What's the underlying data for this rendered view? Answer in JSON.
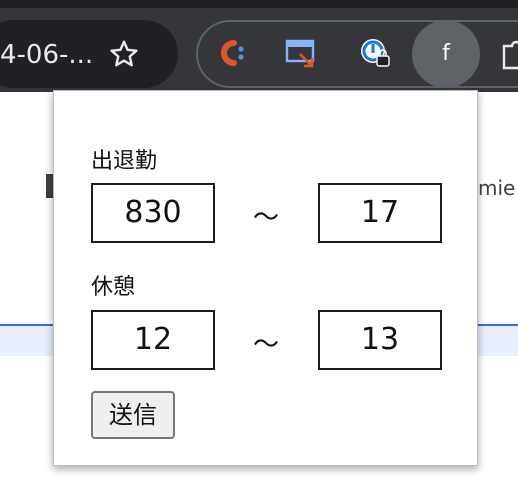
{
  "browser": {
    "url_fragment": "4-06-...",
    "profile_letter": "f",
    "icons": {
      "star": "star-icon",
      "extension_1": "c-extension-icon",
      "extension_2": "screen-capture-extension-icon",
      "extension_3": "password-manager-extension-icon",
      "extensions_menu": "puzzle-icon"
    }
  },
  "page_behind": {
    "right_text": "mie"
  },
  "popup": {
    "work_label": "出退勤",
    "work_start": "830",
    "work_end": "17",
    "break_label": "休憩",
    "break_start": "12",
    "break_end": "13",
    "range_separator": "～",
    "submit_label": "送信"
  },
  "colors": {
    "toolbar_bg": "#35363a",
    "omnibox_bg": "#202124",
    "accent_blue": "#3b6fd4",
    "ext_orange": "#e0542b"
  }
}
